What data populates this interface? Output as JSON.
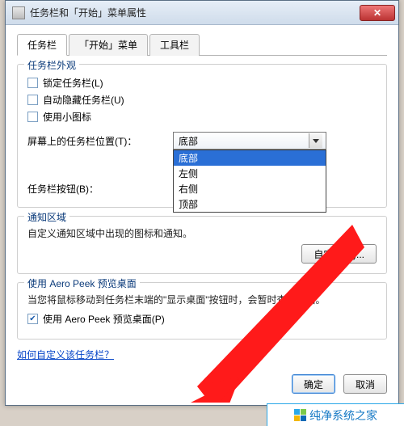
{
  "titlebar": {
    "title": "任务栏和「开始」菜单属性"
  },
  "tabs": [
    {
      "label": "任务栏",
      "active": true
    },
    {
      "label": "「开始」菜单",
      "active": false
    },
    {
      "label": "工具栏",
      "active": false
    }
  ],
  "appearance": {
    "title": "任务栏外观",
    "lock": "锁定任务栏(L)",
    "autohide": "自动隐藏任务栏(U)",
    "smallicons": "使用小图标",
    "position_label": "屏幕上的任务栏位置(T)：",
    "position_value": "底部",
    "position_options": [
      "底部",
      "左侧",
      "右侧",
      "顶部"
    ],
    "buttons_label": "任务栏按钮(B)："
  },
  "notify": {
    "title": "通知区域",
    "desc": "自定义通知区域中出现的图标和通知。",
    "customize_btn": "自定义(C)..."
  },
  "aero": {
    "title": "使用 Aero Peek 预览桌面",
    "desc": "当您将鼠标移动到任务栏末端的\"显示桌面\"按钮时，会暂时查看桌面。",
    "checkbox": "使用 Aero Peek 预览桌面(P)",
    "checked": true
  },
  "link": "如何自定义该任务栏？",
  "footer": {
    "ok": "确定",
    "cancel": "取消"
  },
  "watermark": "纯净系统之家"
}
